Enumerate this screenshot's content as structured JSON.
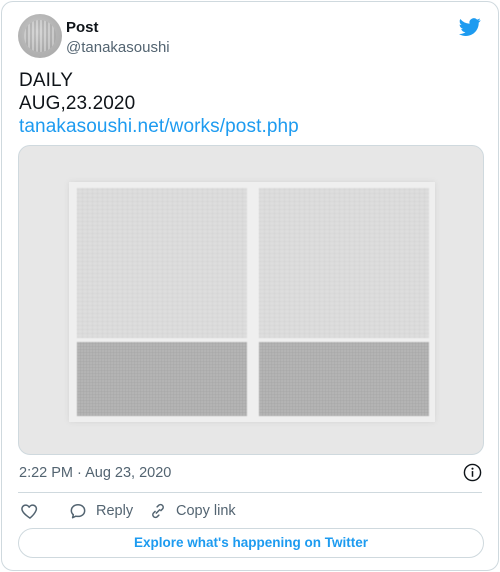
{
  "author": {
    "display_name": "Post",
    "handle": "@tanakasoushi",
    "avatar_icon": "avatar"
  },
  "brand": {
    "logo_icon": "twitter-bird-icon",
    "color": "#1d9bf0"
  },
  "tweet": {
    "lines": [
      "DAILY",
      "AUG,23.2020"
    ],
    "link_text": "tanakasoushi.net/works/post.php",
    "timestamp": "2:22 PM · Aug 23, 2020"
  },
  "actions": {
    "like_icon": "heart-icon",
    "reply_label": "Reply",
    "reply_icon": "reply-bubble-icon",
    "copy_label": "Copy link",
    "copy_icon": "link-icon"
  },
  "footer": {
    "explore_label": "Explore what's happening on Twitter"
  },
  "colors": {
    "text": "#0f1419",
    "secondary": "#536471",
    "border": "#cfd9de"
  }
}
